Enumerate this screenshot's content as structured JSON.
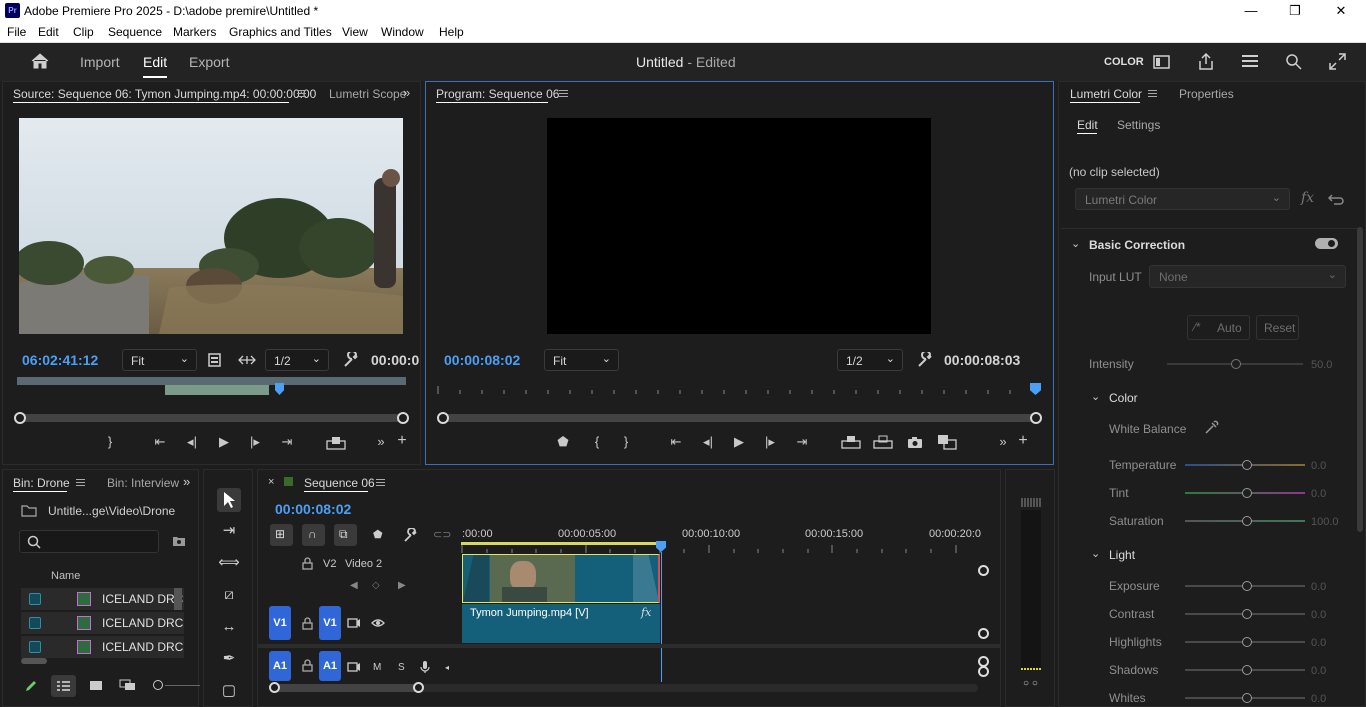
{
  "window": {
    "app_icon_text": "Pr",
    "title": "Adobe Premiere Pro 2025 - D:\\adobe premire\\Untitled *",
    "minimize": "—",
    "maximize": "❐",
    "close": "✕"
  },
  "menu": [
    "File",
    "Edit",
    "Clip",
    "Sequence",
    "Markers",
    "Graphics and Titles",
    "View",
    "Window",
    "Help"
  ],
  "header": {
    "nav": [
      "Import",
      "Edit",
      "Export"
    ],
    "active_nav": "Edit",
    "doc_name": "Untitled",
    "doc_state": " - Edited",
    "workspace_label": "COLOR"
  },
  "source": {
    "tab_label": "Source: Sequence 06: Tymon Jumping.mp4: 00:00:00:00",
    "tab2_label": "Lumetri Scope",
    "timecode": "06:02:41:12",
    "zoom": "Fit",
    "resolution": "1/2",
    "duration": "00:00:0"
  },
  "program": {
    "tab_label": "Program: Sequence 06",
    "timecode": "00:00:08:02",
    "zoom": "Fit",
    "resolution": "1/2",
    "duration": "00:00:08:03"
  },
  "project": {
    "tab_label": "Bin: Drone",
    "tab2_label": "Bin: Interview",
    "path": "Untitle...ge\\Video\\Drone",
    "search_placeholder": "",
    "column_name": "Name",
    "items": [
      "ICELAND DRC",
      "ICELAND DRC",
      "ICELAND DRC"
    ]
  },
  "timeline": {
    "tab_label": "Sequence 06",
    "timecode": "00:00:08:02",
    "ruler": [
      ":00:00",
      "00:00:05:00",
      "00:00:10:00",
      "00:00:15:00",
      "00:00:20:0"
    ],
    "tracks": {
      "v2": "V2",
      "v2_name": "Video 2",
      "v1": "V1",
      "a1": "A1",
      "mute": "M",
      "solo": "S"
    },
    "clip_name": "Tymon Jumping.mp4 [V]",
    "clip_fx": "fx"
  },
  "lumetri": {
    "tab_label": "Lumetri Color",
    "tab2_label": "Properties",
    "subtab_edit": "Edit",
    "subtab_settings": "Settings",
    "no_clip": "(no clip selected)",
    "effect_dropdown": "Lumetri Color",
    "fx_icon": "fx",
    "basic_correction": "Basic Correction",
    "input_lut_label": "Input LUT",
    "input_lut_value": "None",
    "auto_label": "Auto",
    "reset_label": "Reset",
    "intensity_label": "Intensity",
    "intensity_value": "50.0",
    "color_section": "Color",
    "white_balance": "White Balance",
    "color_sliders": [
      {
        "label": "Temperature",
        "value": "0.0"
      },
      {
        "label": "Tint",
        "value": "0.0"
      },
      {
        "label": "Saturation",
        "value": "100.0"
      }
    ],
    "light_section": "Light",
    "light_sliders": [
      {
        "label": "Exposure",
        "value": "0.0"
      },
      {
        "label": "Contrast",
        "value": "0.0"
      },
      {
        "label": "Highlights",
        "value": "0.0"
      },
      {
        "label": "Shadows",
        "value": "0.0"
      },
      {
        "label": "Whites",
        "value": "0.0"
      }
    ]
  },
  "audio_meter_solo": "○ ○",
  "colors": {
    "accent_blue": "#2f67d8",
    "timecode_blue": "#4b9ff5",
    "clip_teal": "#14607a",
    "playhead": "#4b9ff5"
  }
}
